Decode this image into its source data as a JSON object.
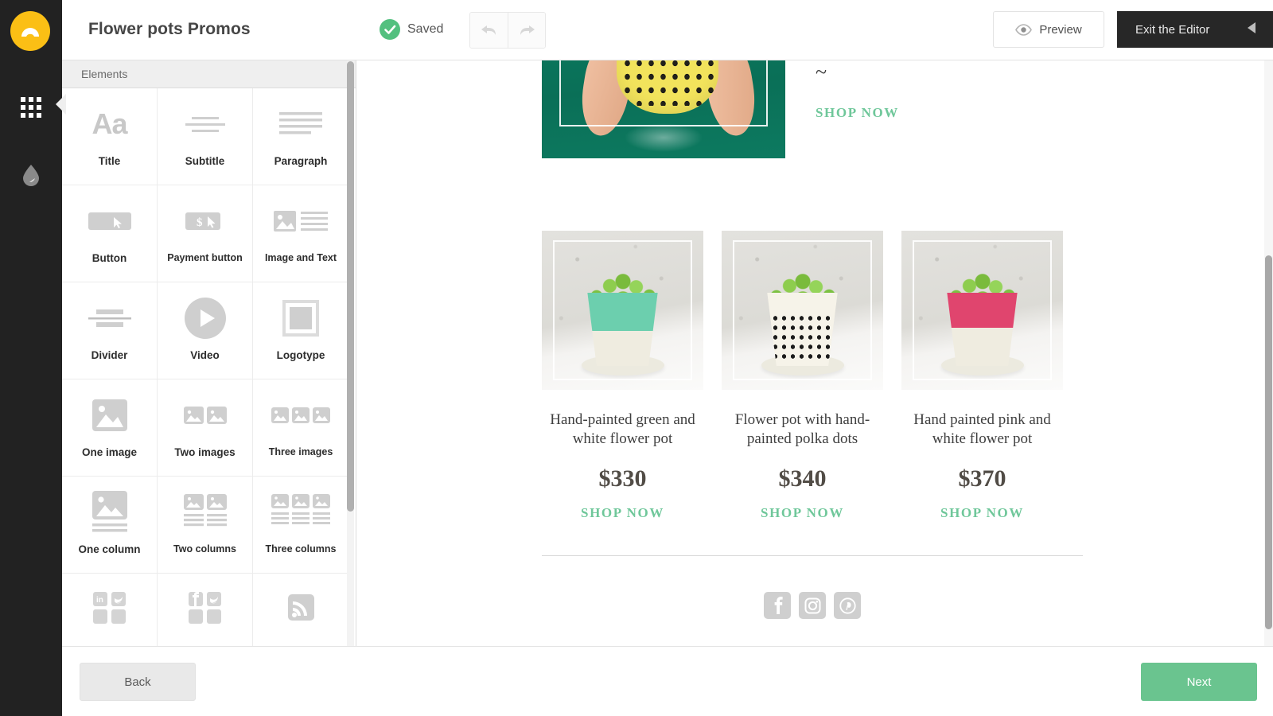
{
  "header": {
    "title": "Flower pots Promos",
    "saved_label": "Saved",
    "undo_icon": "undo-arrow-icon",
    "redo_icon": "redo-arrow-icon",
    "preview_label": "Preview",
    "preview_icon": "eye-icon",
    "exit_label": "Exit the Editor",
    "exit_icon": "triangle-left-icon"
  },
  "rail": {
    "logo_icon": "brand-logo-icon",
    "items": [
      {
        "name": "elements",
        "icon": "grid-icon",
        "active": true
      },
      {
        "name": "design",
        "icon": "droplet-icon",
        "active": false
      }
    ]
  },
  "panel": {
    "header": "Elements",
    "elements": [
      {
        "label": "Title",
        "icon": "text-title-icon"
      },
      {
        "label": "Subtitle",
        "icon": "text-subtitle-icon"
      },
      {
        "label": "Paragraph",
        "icon": "text-paragraph-icon"
      },
      {
        "label": "Button",
        "icon": "button-icon"
      },
      {
        "label": "Payment button",
        "icon": "payment-button-icon"
      },
      {
        "label": "Image and Text",
        "icon": "image-and-text-icon"
      },
      {
        "label": "Divider",
        "icon": "divider-icon"
      },
      {
        "label": "Video",
        "icon": "video-play-icon"
      },
      {
        "label": "Logotype",
        "icon": "logotype-icon"
      },
      {
        "label": "One image",
        "icon": "one-image-icon"
      },
      {
        "label": "Two images",
        "icon": "two-images-icon"
      },
      {
        "label": "Three images",
        "icon": "three-images-icon"
      },
      {
        "label": "One column",
        "icon": "one-column-icon"
      },
      {
        "label": "Two columns",
        "icon": "two-columns-icon"
      },
      {
        "label": "Three columns",
        "icon": "three-columns-icon"
      },
      {
        "label": "",
        "icon": "social-linkedin-twitter-icon"
      },
      {
        "label": "",
        "icon": "social-facebook-twitter-icon"
      },
      {
        "label": "",
        "icon": "rss-feed-icon"
      }
    ]
  },
  "canvas": {
    "hero": {
      "image_alt": "hands holding yellow polka-dot flower pot on teal background",
      "tilde": "~",
      "shop_label": "SHOP NOW"
    },
    "products": [
      {
        "image_alt": "mint green and white hand-painted flower pot with sprouts",
        "pot_color": "#6ccfae",
        "title": "Hand-painted green and white flower pot",
        "price": "$330",
        "shop_label": "SHOP NOW"
      },
      {
        "image_alt": "white flower pot with hand-painted black polka dots and sprouts",
        "pot_color": "#f6f3e9",
        "title": "Flower pot with hand-painted polka dots",
        "price": "$340",
        "shop_label": "SHOP NOW"
      },
      {
        "image_alt": "pink and white hand-painted flower pot with sprouts",
        "pot_color": "#e0456e",
        "title": "Hand painted pink and white flower pot",
        "price": "$370",
        "shop_label": "SHOP NOW"
      }
    ],
    "socials": [
      {
        "name": "facebook",
        "glyph": "f"
      },
      {
        "name": "instagram",
        "glyph": "instagram-icon"
      },
      {
        "name": "pinterest",
        "glyph": "pinterest-icon"
      }
    ]
  },
  "footer": {
    "back_label": "Back",
    "next_label": "Next"
  },
  "colors": {
    "accent_green": "#6ac48f",
    "shop_link_green": "#6fc79a",
    "brand_yellow": "#fbbf15",
    "rail_dark": "#222222",
    "exit_dark": "#272727"
  }
}
